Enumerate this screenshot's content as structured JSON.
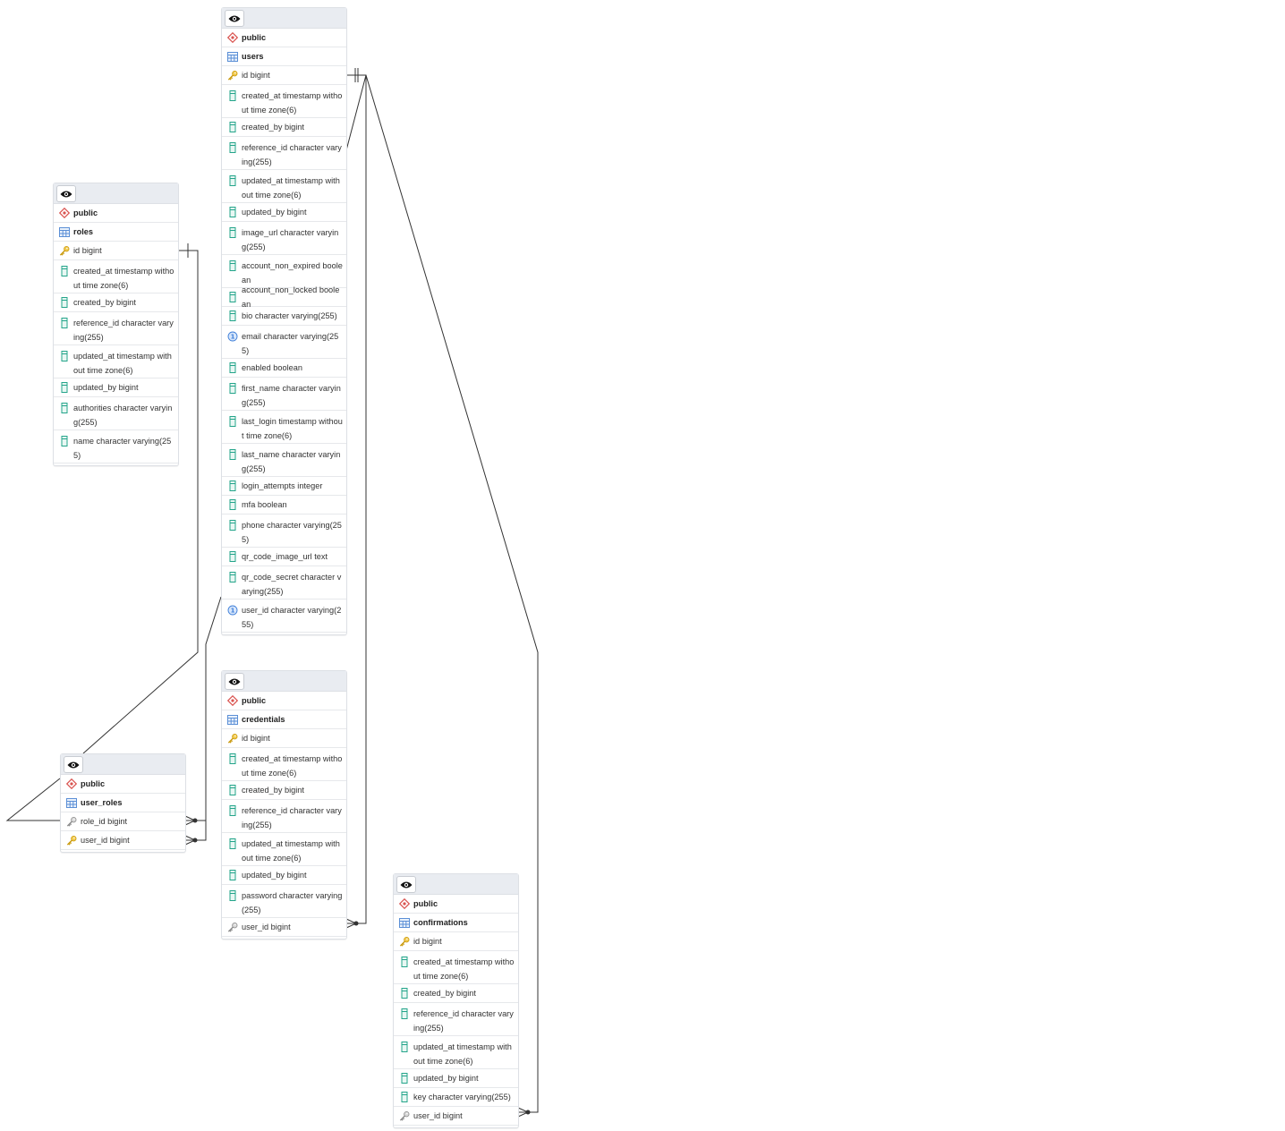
{
  "tables": {
    "users": {
      "schema": "public",
      "name": "users",
      "columns": [
        {
          "text": "id bigint",
          "icon": "primary-key-icon"
        },
        {
          "text": "created_at timestamp without time zone(6)",
          "icon": "column-icon"
        },
        {
          "text": "created_by bigint",
          "icon": "column-icon"
        },
        {
          "text": "reference_id character varying(255)",
          "icon": "column-icon"
        },
        {
          "text": "updated_at timestamp without time zone(6)",
          "icon": "column-icon"
        },
        {
          "text": "updated_by bigint",
          "icon": "column-icon"
        },
        {
          "text": "image_url character varying(255)",
          "icon": "column-icon"
        },
        {
          "text": "account_non_expired boolean",
          "icon": "column-icon"
        },
        {
          "text": "account_non_locked boolean",
          "icon": "column-icon"
        },
        {
          "text": "bio character varying(255)",
          "icon": "column-icon"
        },
        {
          "text": "email character varying(255)",
          "icon": "unique-icon"
        },
        {
          "text": "enabled boolean",
          "icon": "column-icon"
        },
        {
          "text": "first_name character varying(255)",
          "icon": "column-icon"
        },
        {
          "text": "last_login timestamp without time zone(6)",
          "icon": "column-icon"
        },
        {
          "text": "last_name character varying(255)",
          "icon": "column-icon"
        },
        {
          "text": "login_attempts integer",
          "icon": "column-icon"
        },
        {
          "text": "mfa boolean",
          "icon": "column-icon"
        },
        {
          "text": "phone character varying(255)",
          "icon": "column-icon"
        },
        {
          "text": "qr_code_image_url text",
          "icon": "column-icon"
        },
        {
          "text": "qr_code_secret character varying(255)",
          "icon": "column-icon"
        },
        {
          "text": "user_id character varying(255)",
          "icon": "unique-icon"
        }
      ]
    },
    "roles": {
      "schema": "public",
      "name": "roles",
      "columns": [
        {
          "text": "id bigint",
          "icon": "primary-key-icon"
        },
        {
          "text": "created_at timestamp without time zone(6)",
          "icon": "column-icon"
        },
        {
          "text": "created_by bigint",
          "icon": "column-icon"
        },
        {
          "text": "reference_id character varying(255)",
          "icon": "column-icon"
        },
        {
          "text": "updated_at timestamp without time zone(6)",
          "icon": "column-icon"
        },
        {
          "text": "updated_by bigint",
          "icon": "column-icon"
        },
        {
          "text": "authorities character varying(255)",
          "icon": "column-icon"
        },
        {
          "text": "name character varying(255)",
          "icon": "column-icon"
        }
      ]
    },
    "user_roles": {
      "schema": "public",
      "name": "user_roles",
      "columns": [
        {
          "text": "role_id bigint",
          "icon": "foreign-key-icon"
        },
        {
          "text": "user_id bigint",
          "icon": "primary-key-icon"
        }
      ]
    },
    "credentials": {
      "schema": "public",
      "name": "credentials",
      "columns": [
        {
          "text": "id bigint",
          "icon": "primary-key-icon"
        },
        {
          "text": "created_at timestamp without time zone(6)",
          "icon": "column-icon"
        },
        {
          "text": "created_by bigint",
          "icon": "column-icon"
        },
        {
          "text": "reference_id character varying(255)",
          "icon": "column-icon"
        },
        {
          "text": "updated_at timestamp without time zone(6)",
          "icon": "column-icon"
        },
        {
          "text": "updated_by bigint",
          "icon": "column-icon"
        },
        {
          "text": "password character varying(255)",
          "icon": "column-icon"
        },
        {
          "text": "user_id bigint",
          "icon": "foreign-key-icon"
        }
      ]
    },
    "confirmations": {
      "schema": "public",
      "name": "confirmations",
      "columns": [
        {
          "text": "id bigint",
          "icon": "primary-key-icon"
        },
        {
          "text": "created_at timestamp without time zone(6)",
          "icon": "column-icon"
        },
        {
          "text": "created_by bigint",
          "icon": "column-icon"
        },
        {
          "text": "reference_id character varying(255)",
          "icon": "column-icon"
        },
        {
          "text": "updated_at timestamp without time zone(6)",
          "icon": "column-icon"
        },
        {
          "text": "updated_by bigint",
          "icon": "column-icon"
        },
        {
          "text": "key character varying(255)",
          "icon": "column-icon"
        },
        {
          "text": "user_id bigint",
          "icon": "foreign-key-icon"
        }
      ]
    }
  },
  "relationships": [
    {
      "from": "credentials.user_id",
      "to": "users.id",
      "type": "many-to-one"
    },
    {
      "from": "confirmations.user_id",
      "to": "users.id",
      "type": "many-to-one"
    },
    {
      "from": "user_roles.role_id",
      "to": "roles.id",
      "type": "many-to-one"
    },
    {
      "from": "user_roles.user_id",
      "to": "users.id",
      "type": "many-to-one"
    }
  ],
  "colors": {
    "header_bg": "#e9ecf1",
    "border": "#dde0e5",
    "line": "#333333",
    "schema_icon": "#d9534f",
    "table_icon": "#5b8fd6",
    "column_icon": "#23a48a",
    "key_icon": "#e6b82e",
    "unique_icon": "#3f7fd9"
  }
}
